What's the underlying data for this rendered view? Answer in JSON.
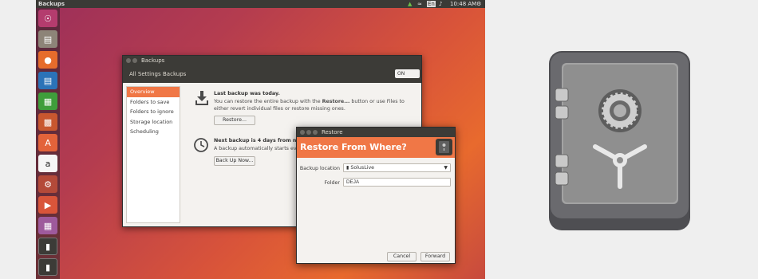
{
  "topbar": {
    "app_title": "Backups",
    "keyboard_layout": "En",
    "clock": "10:48 AM"
  },
  "launcher": {
    "icons": [
      "ubuntu-logo",
      "files",
      "firefox",
      "writer",
      "calc",
      "impress",
      "software-center",
      "amazon",
      "settings",
      "videos",
      "workspace",
      "usb-drive",
      "usb-drive"
    ]
  },
  "backups_window": {
    "title": "Backups",
    "breadcrumb": [
      "All Settings",
      "Backups"
    ],
    "switch_label": "ON",
    "sidebar": [
      "Overview",
      "Folders to save",
      "Folders to ignore",
      "Storage location",
      "Scheduling"
    ],
    "last_backup_title": "Last backup was today.",
    "last_backup_line1_pre": "You can restore the entire backup with the ",
    "last_backup_line1_bold": "Restore...",
    "last_backup_line1_post": " button or use Files to",
    "last_backup_line2": "either revert individual files or restore missing ones.",
    "restore_button": "Restore...",
    "next_backup_title": "Next backup is 4 days from now.",
    "next_backup_text": "A backup automatically starts every",
    "backup_now_button": "Back Up Now..."
  },
  "restore_dialog": {
    "title": "Restore",
    "heading": "Restore From Where?",
    "backup_location_label": "Backup location",
    "backup_location_value": "SolusLive",
    "folder_label": "Folder",
    "folder_value": "DEJA",
    "cancel_button": "Cancel",
    "forward_button": "Forward"
  },
  "colors": {
    "accent": "#f07746",
    "titlebar": "#3c3b37",
    "safe_body": "#5c5c5f",
    "safe_door": "#9a9a9a"
  }
}
